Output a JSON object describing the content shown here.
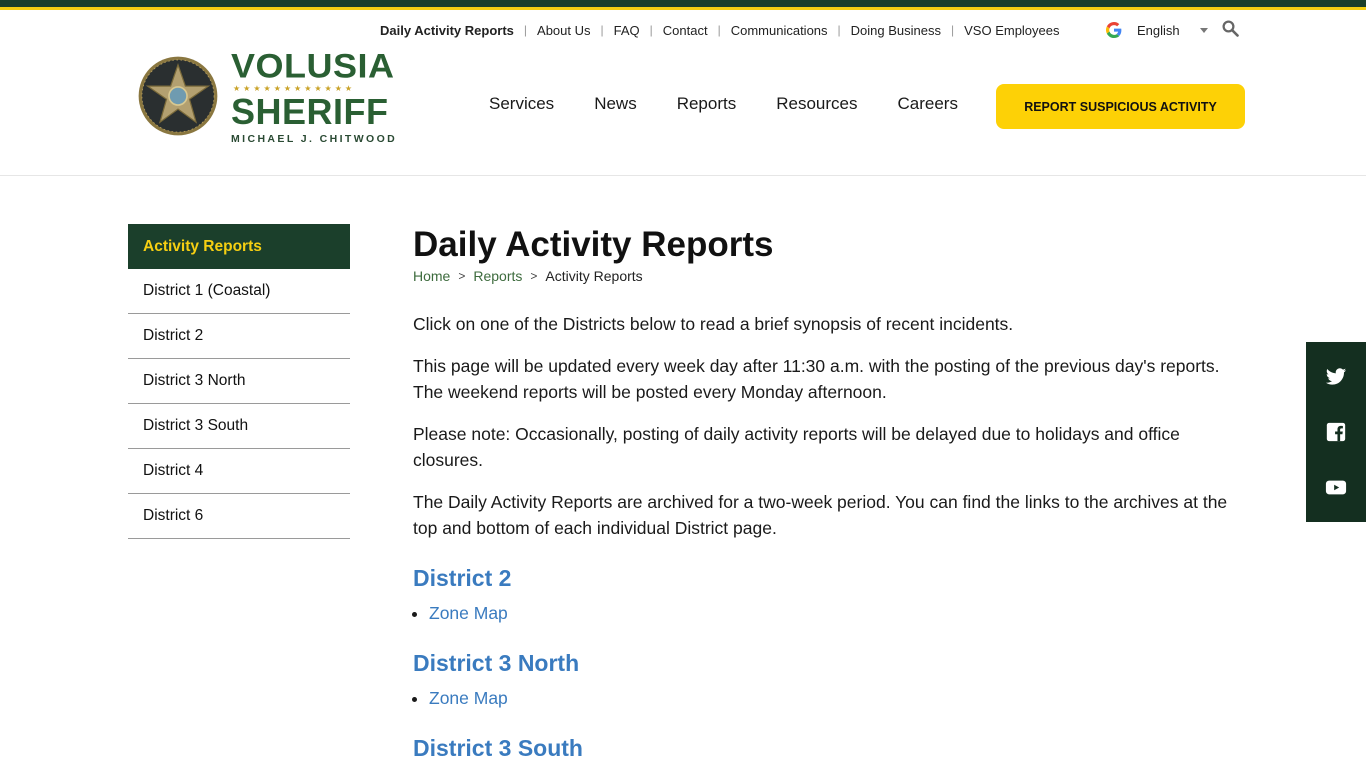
{
  "brand": {
    "name_line1": "VOLUSIA",
    "stars": "★★★★★★★★★★★★",
    "name_line2": "SHERIFF",
    "sheriff_name": "MICHAEL J. CHITWOOD",
    "colors": {
      "green": "#1b3f2b",
      "yellow": "#f6cf12",
      "link_blue": "#3a7bbf"
    }
  },
  "utility_nav": [
    {
      "label": "Daily Activity Reports",
      "active": true
    },
    {
      "label": "About Us"
    },
    {
      "label": "FAQ"
    },
    {
      "label": "Contact"
    },
    {
      "label": "Communications"
    },
    {
      "label": "Doing Business"
    },
    {
      "label": "VSO Employees"
    }
  ],
  "language": {
    "selected": "English"
  },
  "main_nav": [
    "Services",
    "News",
    "Reports",
    "Resources",
    "Careers"
  ],
  "cta_button": "REPORT SUSPICIOUS ACTIVITY",
  "sidebar": {
    "header": "Activity Reports",
    "items": [
      "District 1 (Coastal)",
      "District 2",
      "District 3 North",
      "District 3 South",
      "District 4",
      "District 6"
    ]
  },
  "page": {
    "title": "Daily Activity Reports",
    "breadcrumb": [
      "Home",
      "Reports",
      "Activity Reports"
    ],
    "paragraphs": [
      "Click on one of the Districts below to read a brief synopsis of recent incidents.",
      "This page will be updated every week day after 11:30 a.m. with the posting of the previous day's reports. The weekend reports will be posted every Monday afternoon.",
      "Please note: Occasionally, posting of daily activity reports will be delayed due to holidays and office closures.",
      "The Daily Activity Reports are archived for a two-week period. You can find the links to the archives at the top and bottom of each individual District page."
    ],
    "districts": [
      {
        "title": "District 2",
        "links": [
          "Zone Map"
        ]
      },
      {
        "title": "District 3 North",
        "links": [
          "Zone Map"
        ]
      },
      {
        "title": "District 3 South"
      }
    ]
  },
  "social": [
    "twitter-icon",
    "facebook-icon",
    "youtube-icon"
  ]
}
